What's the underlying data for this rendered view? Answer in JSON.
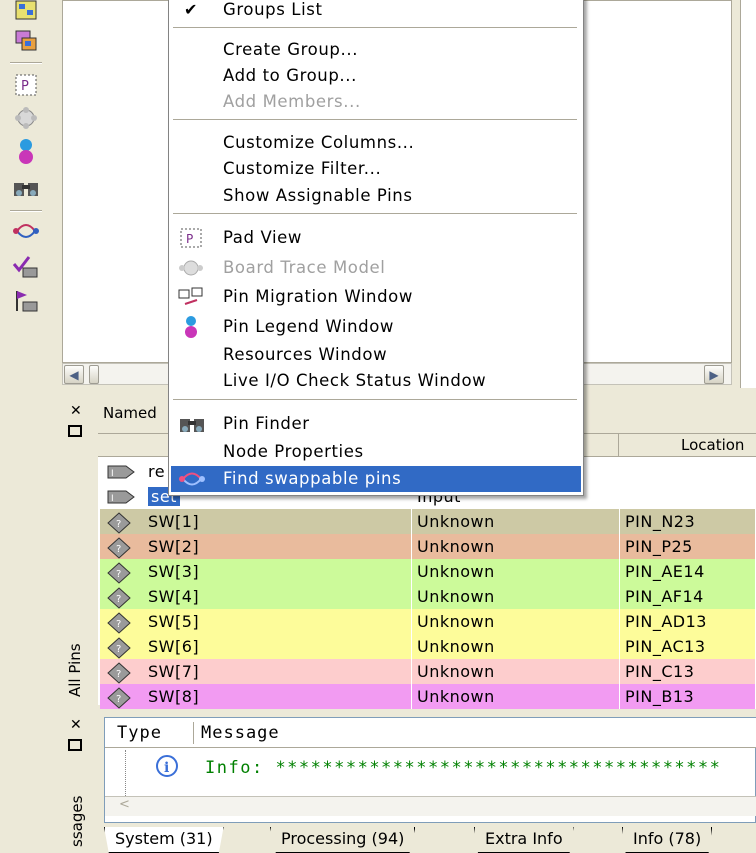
{
  "context_menu": {
    "items": [
      {
        "label": "Groups List",
        "checked": true,
        "enabled": true
      },
      {
        "label": "Create Group...",
        "enabled": true
      },
      {
        "label": "Add to Group...",
        "enabled": true
      },
      {
        "label": "Add Members...",
        "enabled": false
      },
      {
        "label": "Customize Columns...",
        "enabled": true
      },
      {
        "label": "Customize Filter...",
        "enabled": true
      },
      {
        "label": "Show Assignable Pins",
        "enabled": true
      },
      {
        "label": "Pad View",
        "icon": "pad-view-icon",
        "enabled": true
      },
      {
        "label": "Board Trace Model",
        "icon": "board-trace-icon",
        "enabled": false
      },
      {
        "label": "Pin Migration Window",
        "icon": "pin-migration-icon",
        "enabled": true
      },
      {
        "label": "Pin Legend Window",
        "icon": "pin-legend-icon",
        "enabled": true
      },
      {
        "label": "Resources Window",
        "enabled": true
      },
      {
        "label": "Live I/O Check Status Window",
        "enabled": true
      },
      {
        "label": "Pin Finder",
        "icon": "binoculars-icon",
        "enabled": true
      },
      {
        "label": "Node Properties",
        "enabled": true
      },
      {
        "label": "Find swappable pins",
        "icon": "swap-pins-icon",
        "enabled": true,
        "highlighted": true
      }
    ],
    "check_mark": "✔"
  },
  "pins_window": {
    "side_label": "All Pins",
    "named_label": "Named",
    "column_location": "Location",
    "rows": [
      {
        "name": "re",
        "direction": "",
        "location": "",
        "color": "#ffffff"
      },
      {
        "name": "set",
        "direction": "Input",
        "location": "",
        "color": "#ffffff",
        "selected": true
      },
      {
        "name": "SW[1]",
        "direction": "Unknown",
        "location": "PIN_N23",
        "color": "#cdc9a5"
      },
      {
        "name": "SW[2]",
        "direction": "Unknown",
        "location": "PIN_P25",
        "color": "#e9bb9d"
      },
      {
        "name": "SW[3]",
        "direction": "Unknown",
        "location": "PIN_AE14",
        "color": "#ccfa9a"
      },
      {
        "name": "SW[4]",
        "direction": "Unknown",
        "location": "PIN_AF14",
        "color": "#ccfa9a"
      },
      {
        "name": "SW[5]",
        "direction": "Unknown",
        "location": "PIN_AD13",
        "color": "#fdfc9a"
      },
      {
        "name": "SW[6]",
        "direction": "Unknown",
        "location": "PIN_AC13",
        "color": "#fdfc9a"
      },
      {
        "name": "SW[7]",
        "direction": "Unknown",
        "location": "PIN_C13",
        "color": "#fdcdcd"
      },
      {
        "name": "SW[8]",
        "direction": "Unknown",
        "location": "PIN_B13",
        "color": "#f29bf2"
      }
    ]
  },
  "messages_window": {
    "side_label": "ssages",
    "col_type": "Type",
    "col_message": "Message",
    "info_prefix": "Info:",
    "info_text": "**************************************",
    "tabs": [
      "System (31)",
      "Processing (94)",
      "Extra Info",
      "Info (78)"
    ]
  },
  "colors": {
    "menu_highlight": "#316ac5",
    "window_bg": "#ece9d8",
    "info_text": "#008000"
  }
}
